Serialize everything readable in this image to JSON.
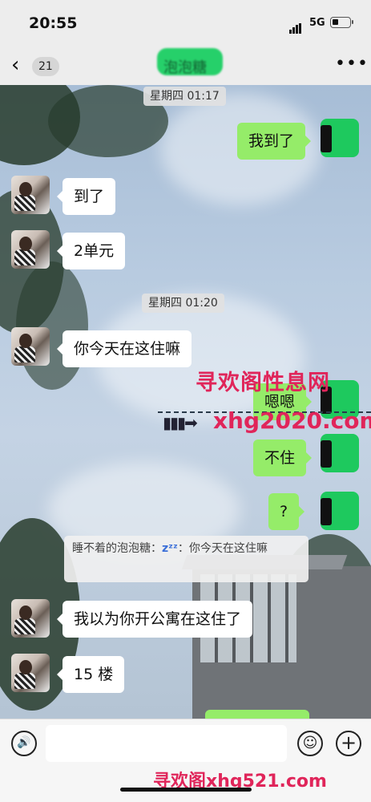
{
  "status": {
    "time": "20:55",
    "network": "5G"
  },
  "nav": {
    "back_count": "21",
    "title": "泡泡糖",
    "more": "•••"
  },
  "timestamps": [
    "星期四 01:17",
    "星期四 01:20"
  ],
  "messages": [
    {
      "side": "out",
      "text": "我到了"
    },
    {
      "side": "in",
      "text": "到了"
    },
    {
      "side": "in",
      "text": "2单元"
    },
    {
      "side": "in",
      "text": "你今天在这住嘛"
    },
    {
      "side": "out",
      "text": "嗯嗯"
    },
    {
      "side": "out",
      "text": "不住"
    },
    {
      "side": "out",
      "text": "?"
    },
    {
      "side": "in",
      "text": "我以为你开公寓在这住了"
    },
    {
      "side": "in",
      "text": "15 楼"
    }
  ],
  "quote": {
    "prefix": "睡不着的泡泡糖：",
    "zz": "zᶻᶻ",
    "text": "：你今天在这住嘛"
  },
  "watermark": {
    "line1": "寻欢阁性息网",
    "line2": "xhg2020.com",
    "arrow": "▮▮▮➡",
    "bottom": "寻欢阁xhg521.com"
  },
  "input": {
    "voice_icon": "🔊",
    "emoji_icon": "☺",
    "plus_icon": "+"
  },
  "colors": {
    "outgoing_bubble": "#95ec69",
    "incoming_bubble": "#ffffff",
    "watermark": "#e0255a",
    "bar_bg": "#ededed"
  }
}
